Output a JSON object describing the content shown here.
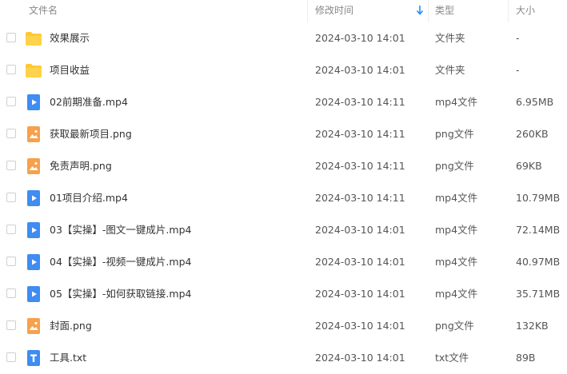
{
  "header": {
    "name": "文件名",
    "modified": "修改时间",
    "type": "类型",
    "size": "大小"
  },
  "files": [
    {
      "name": "效果展示",
      "modified": "2024-03-10 14:01",
      "type": "文件夹",
      "size": "-",
      "icon": "folder-icon"
    },
    {
      "name": "项目收益",
      "modified": "2024-03-10 14:01",
      "type": "文件夹",
      "size": "-",
      "icon": "folder-icon"
    },
    {
      "name": "02前期准备.mp4",
      "modified": "2024-03-10 14:11",
      "type": "mp4文件",
      "size": "6.95MB",
      "icon": "video-file-icon"
    },
    {
      "name": "获取最新项目.png",
      "modified": "2024-03-10 14:11",
      "type": "png文件",
      "size": "260KB",
      "icon": "image-file-icon"
    },
    {
      "name": "免责声明.png",
      "modified": "2024-03-10 14:11",
      "type": "png文件",
      "size": "69KB",
      "icon": "image-file-icon"
    },
    {
      "name": "01项目介绍.mp4",
      "modified": "2024-03-10 14:11",
      "type": "mp4文件",
      "size": "10.79MB",
      "icon": "video-file-icon"
    },
    {
      "name": "03【实操】-图文一键成片.mp4",
      "modified": "2024-03-10 14:01",
      "type": "mp4文件",
      "size": "72.14MB",
      "icon": "video-file-icon"
    },
    {
      "name": "04【实操】-视频一键成片.mp4",
      "modified": "2024-03-10 14:01",
      "type": "mp4文件",
      "size": "40.97MB",
      "icon": "video-file-icon"
    },
    {
      "name": "05【实操】-如何获取链接.mp4",
      "modified": "2024-03-10 14:01",
      "type": "mp4文件",
      "size": "35.71MB",
      "icon": "video-file-icon"
    },
    {
      "name": "封面.png",
      "modified": "2024-03-10 14:01",
      "type": "png文件",
      "size": "132KB",
      "icon": "image-file-icon"
    },
    {
      "name": "工具.txt",
      "modified": "2024-03-10 14:01",
      "type": "txt文件",
      "size": "89B",
      "icon": "text-file-icon"
    }
  ],
  "colors": {
    "accent": "#1e90ff",
    "folder": "#ffc933",
    "video": "#3f8cf2",
    "image": "#f7a14a",
    "text": "#3f8cf2"
  }
}
